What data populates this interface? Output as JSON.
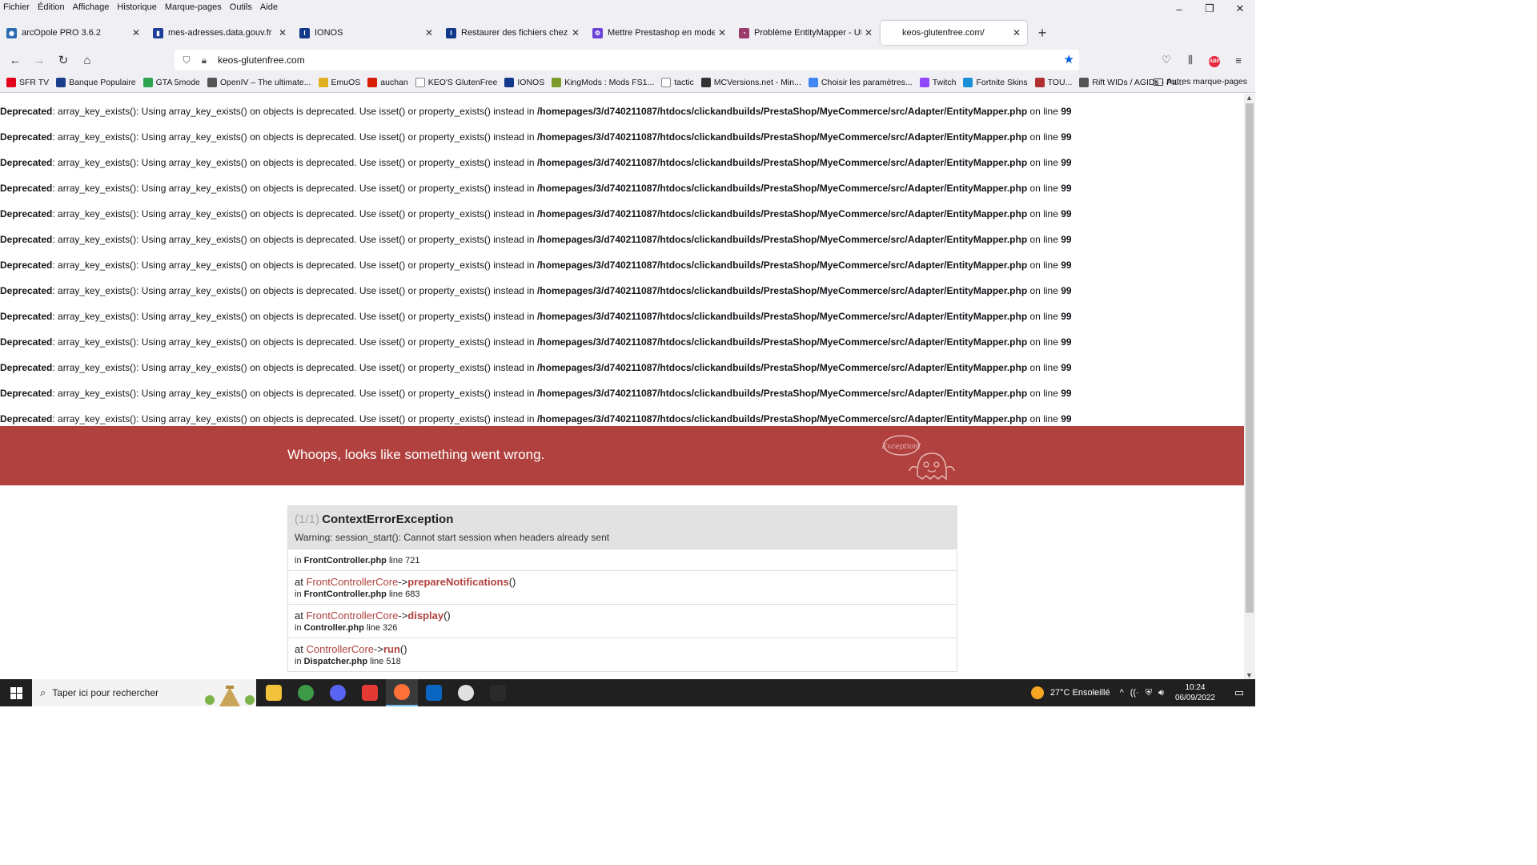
{
  "menubar": [
    "Fichier",
    "Édition",
    "Affichage",
    "Historique",
    "Marque-pages",
    "Outils",
    "Aide"
  ],
  "window_controls": {
    "minimize": "–",
    "restore": "❐",
    "close": "✕"
  },
  "tabs": [
    {
      "label": "arcOpole PRO 3.6.2",
      "favicon_color": "#2b6cb0",
      "favicon_glyph": "◉"
    },
    {
      "label": "mes-adresses.data.gouv.fr",
      "favicon_color": "#1f3d99",
      "favicon_glyph": "▮"
    },
    {
      "label": "IONOS",
      "favicon_color": "#11388a",
      "favicon_glyph": "I"
    },
    {
      "label": "Restaurer des fichiers chez IONOS",
      "favicon_color": "#11388a",
      "favicon_glyph": "I"
    },
    {
      "label": "Mettre Prestashop en mode debug",
      "favicon_color": "#6a42d6",
      "favicon_glyph": "⚙"
    },
    {
      "label": "Problème EntityMapper - Utilisat",
      "favicon_color": "#9a3a6a",
      "favicon_glyph": "◔"
    },
    {
      "label": "keos-glutenfree.com/",
      "favicon_color": "#ffffff",
      "favicon_glyph": ""
    }
  ],
  "newtab_label": "+",
  "url": "keos-glutenfree.com",
  "bookmarks": [
    {
      "label": "SFR TV",
      "color": "#e2001a"
    },
    {
      "label": "Banque Populaire",
      "color": "#1a3e8c"
    },
    {
      "label": "GTA 5mode",
      "color": "#2ea44f"
    },
    {
      "label": "OpenIV – The ultimate...",
      "color": "#555555"
    },
    {
      "label": "EmuOS",
      "color": "#e0b020"
    },
    {
      "label": "auchan",
      "color": "#d81e05"
    },
    {
      "label": "KEO'S GlutenFree",
      "color": "#ffffff"
    },
    {
      "label": "IONOS",
      "color": "#11388a"
    },
    {
      "label": "KingMods : Mods FS1...",
      "color": "#7a9a2a"
    },
    {
      "label": "tactic",
      "color": "#ffffff"
    },
    {
      "label": "MCVersions.net - Min...",
      "color": "#333333"
    },
    {
      "label": "Choisir les paramètres...",
      "color": "#4285f4"
    },
    {
      "label": "Twitch",
      "color": "#9146ff"
    },
    {
      "label": "Fortnite Skins",
      "color": "#1b8fd8"
    },
    {
      "label": "TOU...",
      "color": "#b03030"
    },
    {
      "label": "Rift WIDs / AGIDs - Pa...",
      "color": "#555555"
    }
  ],
  "bookmarks_more": "»",
  "bookmarks_other": "Autres marque-pages",
  "deprecated": {
    "label": "Deprecated",
    "message": ": array_key_exists(): Using array_key_exists() on objects is deprecated. Use isset() or property_exists() instead in ",
    "path": "/homepages/3/d740211087/htdocs/clickandbuilds/PrestaShop/MyeCommerce/src/Adapter/EntityMapper.php",
    "on_line": " on line ",
    "line": "99",
    "count": 13
  },
  "whoops": {
    "title": "Whoops, looks like something went wrong.",
    "badge": "Exception!"
  },
  "exception": {
    "count": "(1/1)",
    "class": "ContextErrorException",
    "message": "Warning: session_start(): Cannot start session when headers already sent",
    "first_in": {
      "prefix": "in ",
      "file": "FrontController.php",
      "line": " line 721"
    },
    "frames": [
      {
        "at": "at ",
        "class": "FrontControllerCore",
        "arrow": "->",
        "method": "prepareNotifications",
        "args": "()",
        "in": "in ",
        "file": "FrontController.php",
        "line": " line 683"
      },
      {
        "at": "at ",
        "class": "FrontControllerCore",
        "arrow": "->",
        "method": "display",
        "args": "()",
        "in": "in ",
        "file": "Controller.php",
        "line": " line 326"
      },
      {
        "at": "at ",
        "class": "ControllerCore",
        "arrow": "->",
        "method": "run",
        "args": "()",
        "in": "in ",
        "file": "Dispatcher.php",
        "line": " line 518"
      }
    ]
  },
  "taskbar": {
    "search_placeholder": "Taper ici pour rechercher",
    "apps": [
      {
        "name": "file-explorer",
        "color": "#f2c23a"
      },
      {
        "name": "chrome",
        "color": "#3c9a47"
      },
      {
        "name": "discord",
        "color": "#5865f2"
      },
      {
        "name": "anydesk",
        "color": "#e53935"
      },
      {
        "name": "firefox",
        "color": "#ff7139"
      },
      {
        "name": "mail",
        "color": "#0a66c2"
      },
      {
        "name": "app-7",
        "color": "#e0e0e0"
      },
      {
        "name": "epic-games",
        "color": "#2a2a2a"
      }
    ],
    "weather": "27°C  Ensoleillé",
    "time": "10:24",
    "date": "06/09/2022"
  }
}
